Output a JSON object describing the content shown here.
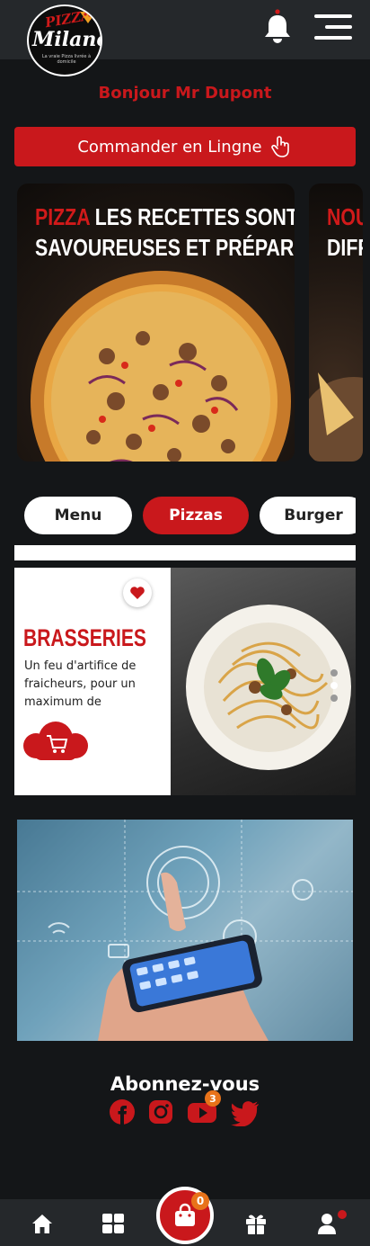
{
  "header": {
    "logo": {
      "line1": "PIZZA",
      "line2": "Milano",
      "tagline": "La vraie Pizza livrée à domicile"
    },
    "notification_dot": true
  },
  "greeting": "Bonjour Mr Dupont",
  "order_button": {
    "label": "Commander en Lingne"
  },
  "carousel": {
    "slides": [
      {
        "title_highlight": "PIZZA",
        "title_rest": "LES RECETTES SONT",
        "title_line2": "SAVOUREUSES ET PRÉPARÉE"
      },
      {
        "title_highlight": "NOU",
        "title_rest": "",
        "title_line2": "DIFF"
      }
    ]
  },
  "categories": [
    {
      "label": "Menu",
      "active": false
    },
    {
      "label": "Pizzas",
      "active": true
    },
    {
      "label": "Burger",
      "active": false
    }
  ],
  "promo": {
    "title": "BRASSERIES",
    "description": "Un feu d'artifice de fraicheurs, pour un maximum de",
    "favorite": true,
    "pager": {
      "count": 3,
      "active_index": 1
    }
  },
  "social": {
    "title": "Abonnez-vous",
    "networks": [
      "facebook-icon",
      "instagram-icon",
      "youtube-icon",
      "twitter-icon"
    ],
    "youtube_badge": "3"
  },
  "bottom_nav": {
    "items": [
      "home-icon",
      "grid-icon",
      "cart-icon",
      "gift-icon",
      "user-icon"
    ],
    "cart_count": "0",
    "user_dot": true
  },
  "colors": {
    "accent": "#c9181c",
    "background": "#141618",
    "bar": "#25282b",
    "badge": "#e8731a"
  }
}
